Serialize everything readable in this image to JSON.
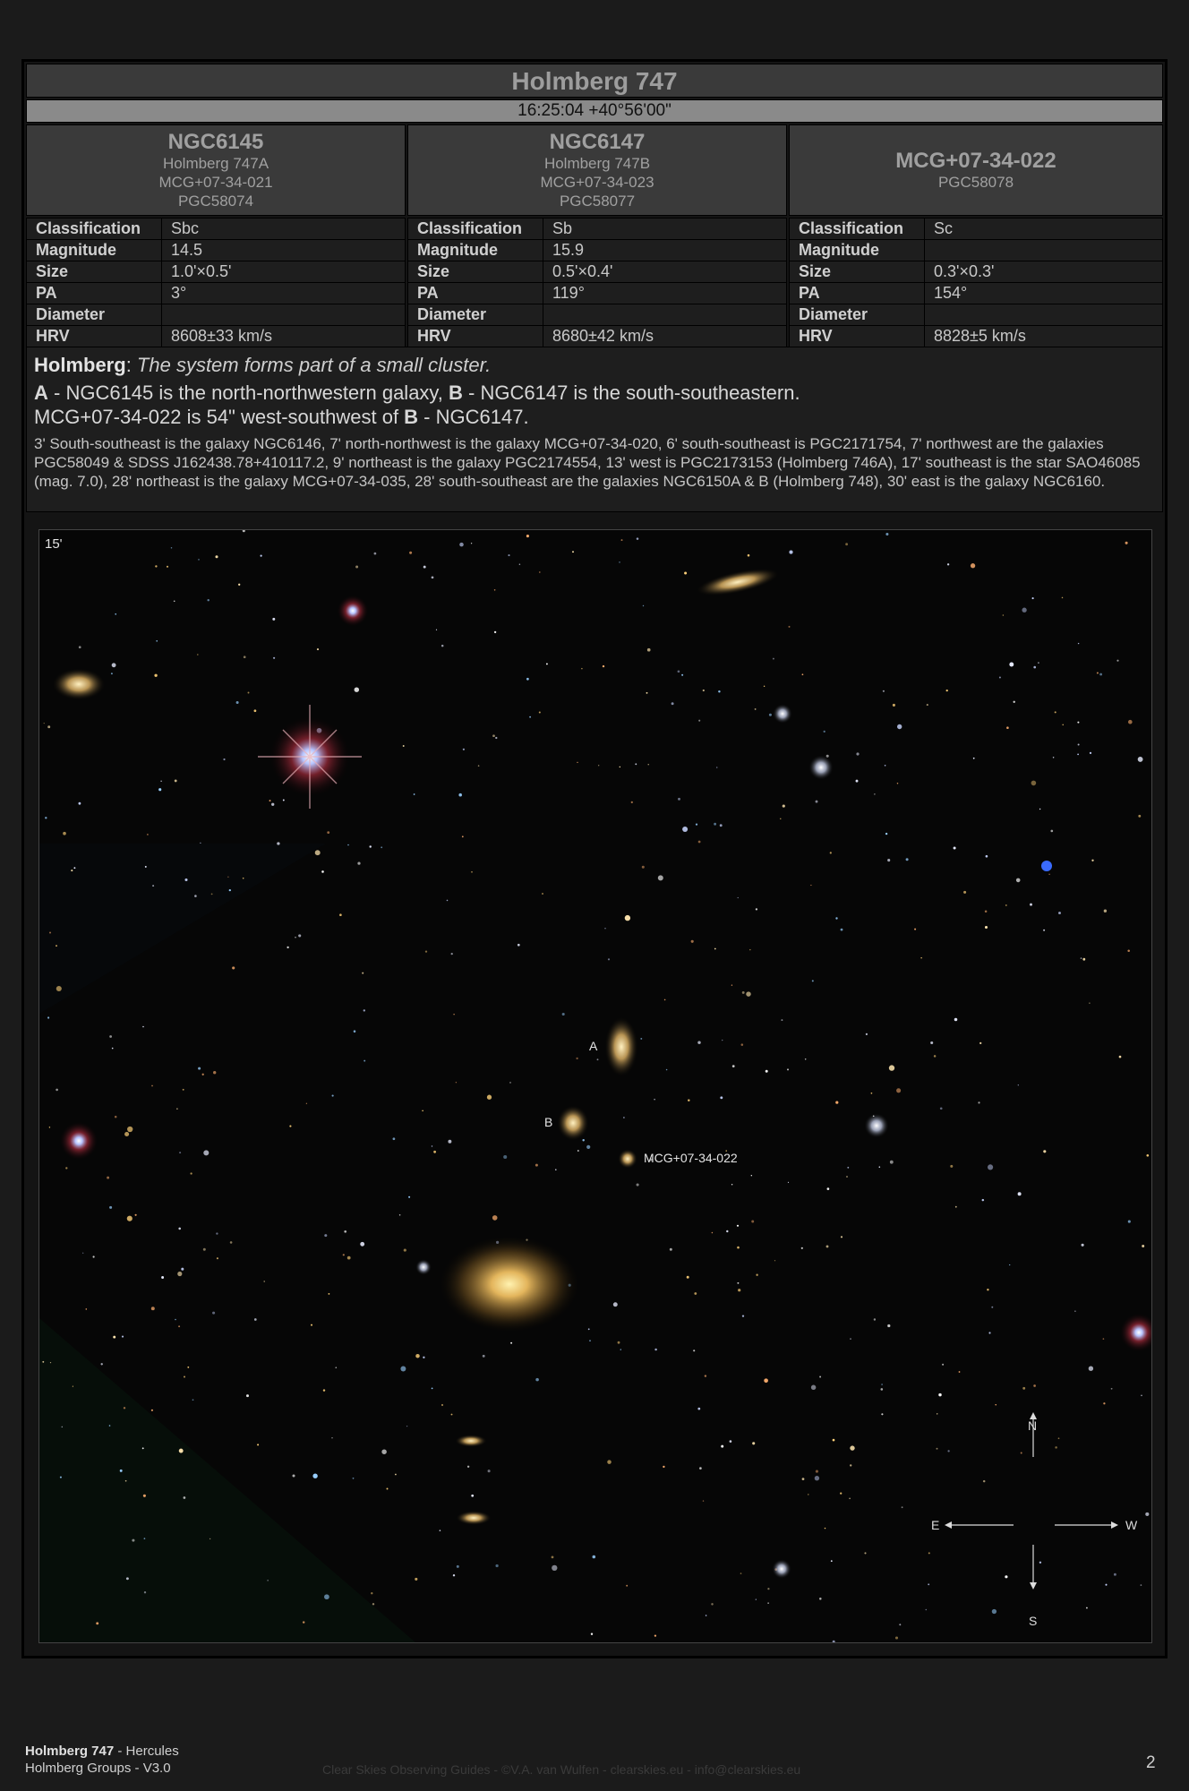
{
  "header": {
    "title": "Holmberg 747",
    "coords": "16:25:04 +40°56'00\""
  },
  "galaxies": [
    {
      "name": "NGC6145",
      "aliases": [
        "Holmberg 747A",
        "MCG+07-34-021",
        "PGC58074"
      ],
      "props": [
        {
          "label": "Classification",
          "value": "Sbc"
        },
        {
          "label": "Magnitude",
          "value": "14.5"
        },
        {
          "label": "Size",
          "value": "1.0'×0.5'"
        },
        {
          "label": "PA",
          "value": "3°"
        },
        {
          "label": "Diameter",
          "value": ""
        },
        {
          "label": "HRV",
          "value": "8608±33 km/s"
        }
      ]
    },
    {
      "name": "NGC6147",
      "aliases": [
        "Holmberg 747B",
        "MCG+07-34-023",
        "PGC58077"
      ],
      "props": [
        {
          "label": "Classification",
          "value": "Sb"
        },
        {
          "label": "Magnitude",
          "value": "15.9"
        },
        {
          "label": "Size",
          "value": "0.5'×0.4'"
        },
        {
          "label": "PA",
          "value": "119°"
        },
        {
          "label": "Diameter",
          "value": ""
        },
        {
          "label": "HRV",
          "value": "8680±42 km/s"
        }
      ]
    },
    {
      "name": "MCG+07-34-022",
      "aliases": [
        "PGC58078"
      ],
      "props": [
        {
          "label": "Classification",
          "value": "Sc"
        },
        {
          "label": "Magnitude",
          "value": ""
        },
        {
          "label": "Size",
          "value": "0.3'×0.3'"
        },
        {
          "label": "PA",
          "value": "154°"
        },
        {
          "label": "Diameter",
          "value": ""
        },
        {
          "label": "HRV",
          "value": "8828±5 km/s"
        }
      ]
    }
  ],
  "description": {
    "holmberg_label": "Holmberg",
    "holmberg_text": "The system forms part of a small cluster.",
    "a_label": "A",
    "a_text": " - NGC6145 is the north-northwestern galaxy, ",
    "b_label": "B",
    "b_text": " - NGC6147 is the south-southeastern.",
    "mcg_text": "MCG+07-34-022 is 54\" west-southwest of ",
    "mcg_b_label": "B",
    "mcg_b_text": " - NGC6147.",
    "surroundings": "3' South-southeast is the galaxy NGC6146, 7' north-northwest is the galaxy MCG+07-34-020, 6' south-southeast is PGC2171754, 7' northwest are the galaxies PGC58049 & SDSS J162438.78+410117.2, 9' northeast is the galaxy PGC2174554, 13' west is PGC2173153 (Holmberg 746A), 17' southeast is the star SAO46085 (mag. 7.0), 28' northeast is the galaxy MCG+07-34-035, 28' south-southeast are the galaxies NGC6150A & B (Holmberg 748), 30' east is the galaxy NGC6160."
  },
  "image": {
    "scale_label": "15'",
    "label_a": "A",
    "label_b": "B",
    "label_mcg": "MCG+07-34-022",
    "compass": {
      "n": "N",
      "s": "S",
      "e": "E",
      "w": "W"
    }
  },
  "footer": {
    "object": "Holmberg 747",
    "constellation": " - Hercules",
    "series": "Holmberg Groups - V3.0",
    "credit": "Clear Skies Observing Guides - ©V.A. van Wulfen - clearskies.eu - info@clearskies.eu",
    "page": "2"
  }
}
